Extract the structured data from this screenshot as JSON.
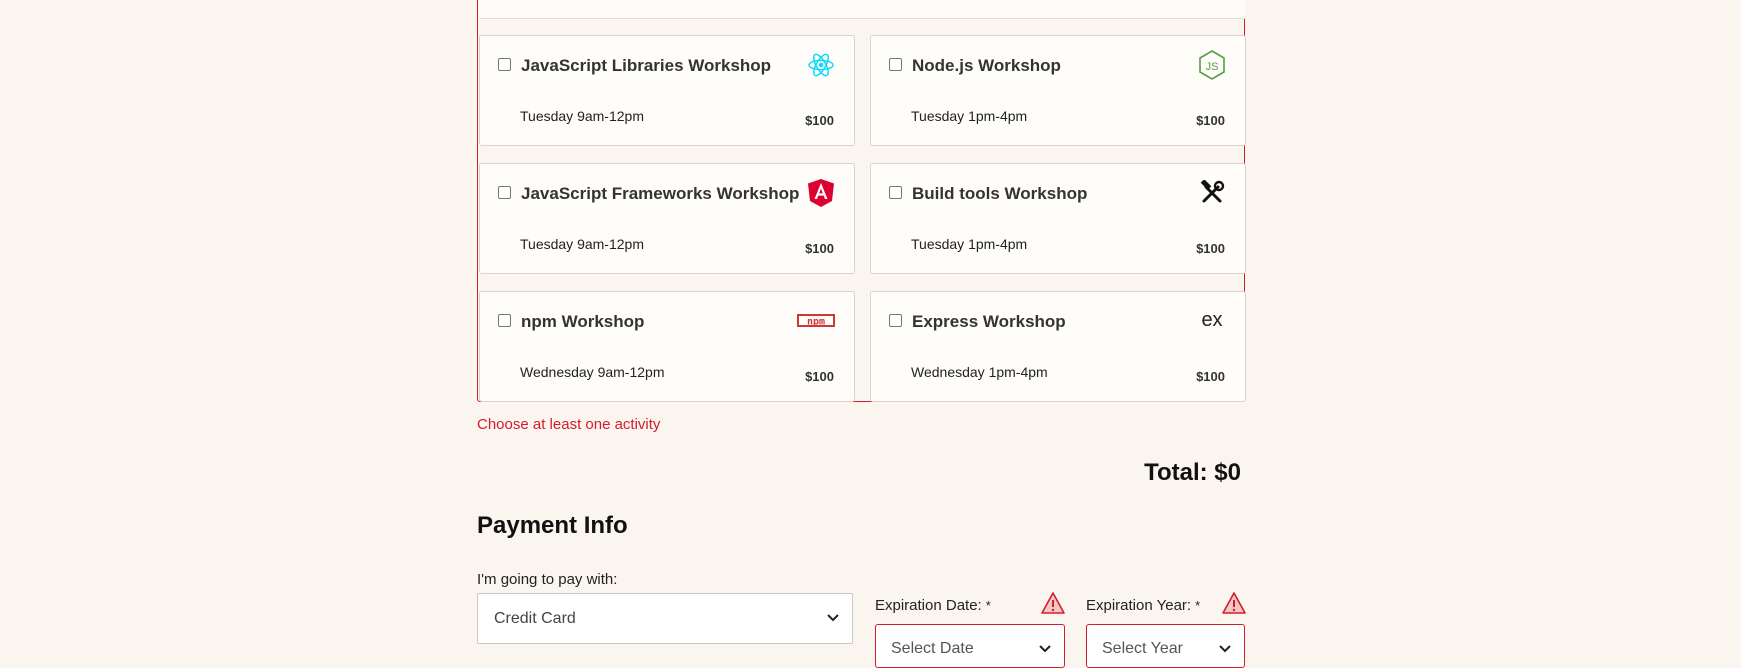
{
  "activities": [
    {
      "name": "JavaScript Libraries Workshop",
      "time": "Tuesday 9am-12pm",
      "price": "$100",
      "icon": "react-icon"
    },
    {
      "name": "Node.js Workshop",
      "time": "Tuesday 1pm-4pm",
      "price": "$100",
      "icon": "nodejs-icon"
    },
    {
      "name": "JavaScript Frameworks Workshop",
      "time": "Tuesday 9am-12pm",
      "price": "$100",
      "icon": "angular-icon"
    },
    {
      "name": "Build tools Workshop",
      "time": "Tuesday 1pm-4pm",
      "price": "$100",
      "icon": "tools-icon"
    },
    {
      "name": "npm Workshop",
      "time": "Wednesday 9am-12pm",
      "price": "$100",
      "icon": "npm-icon"
    },
    {
      "name": "Express Workshop",
      "time": "Wednesday 1pm-4pm",
      "price": "$100",
      "icon": "express-icon"
    }
  ],
  "activities_error": "Choose at least one activity",
  "total": "Total: $0",
  "payment": {
    "title": "Payment Info",
    "pay_label": "I'm going to pay with:",
    "pay_value": "Credit Card",
    "exp_date_label": "Expiration Date:",
    "exp_date_placeholder": "Select Date",
    "exp_year_label": "Expiration Year:",
    "exp_year_placeholder": "Select Year",
    "required_mark": "*"
  },
  "colors": {
    "error": "#d11e2c",
    "react": "#00d8ff",
    "node": "#539e43",
    "angular": "#dd0031",
    "npm": "#cb3837"
  }
}
